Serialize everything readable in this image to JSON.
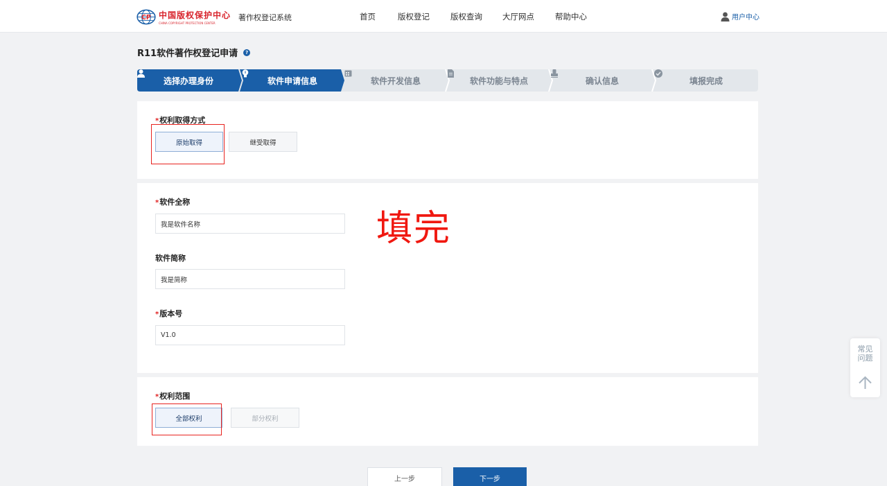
{
  "header": {
    "logo": {
      "cn": "中国版权保护中心",
      "en": "CHINA COPYRIGHT PROTECTION CENTER"
    },
    "system_name": "著作权登记系统",
    "nav": [
      "首页",
      "版权登记",
      "版权查询",
      "大厅网点",
      "帮助中心"
    ],
    "user_center": "用户中心"
  },
  "page_title": "R11软件著作权登记申请",
  "help_icon": "?",
  "steps": [
    {
      "label": "选择办理身份",
      "icon": "user-icon",
      "state": "active"
    },
    {
      "label": "软件申请信息",
      "icon": "bulb-icon",
      "state": "active"
    },
    {
      "label": "软件开发信息",
      "icon": "calendar-icon",
      "state": "inactive"
    },
    {
      "label": "软件功能与特点",
      "icon": "document-icon",
      "state": "inactive"
    },
    {
      "label": "确认信息",
      "icon": "stamp-icon",
      "state": "inactive"
    },
    {
      "label": "填报完成",
      "icon": "check-circle-icon",
      "state": "inactive"
    }
  ],
  "acquisition": {
    "label": "权利取得方式",
    "required_mark": "*",
    "options": [
      "原始取得",
      "继受取得"
    ],
    "selected": "原始取得"
  },
  "software": {
    "full_name": {
      "label": "软件全称",
      "required_mark": "*",
      "value": "我是软件名称"
    },
    "short_name": {
      "label": "软件简称",
      "value": "我是简称"
    },
    "version": {
      "label": "版本号",
      "required_mark": "*",
      "value": "V1.0"
    }
  },
  "scope": {
    "label": "权利范围",
    "required_mark": "*",
    "options": [
      "全部权利",
      "部分权利"
    ],
    "selected": "全部权利"
  },
  "annotation": "填完",
  "buttons": {
    "prev": "上一步",
    "next": "下一步"
  },
  "faq": {
    "line1": "常见",
    "line2": "问题"
  },
  "colors": {
    "primary": "#1a5fa8",
    "annotation_red": "#e8221e",
    "step_inactive": "#e3e7eb"
  }
}
